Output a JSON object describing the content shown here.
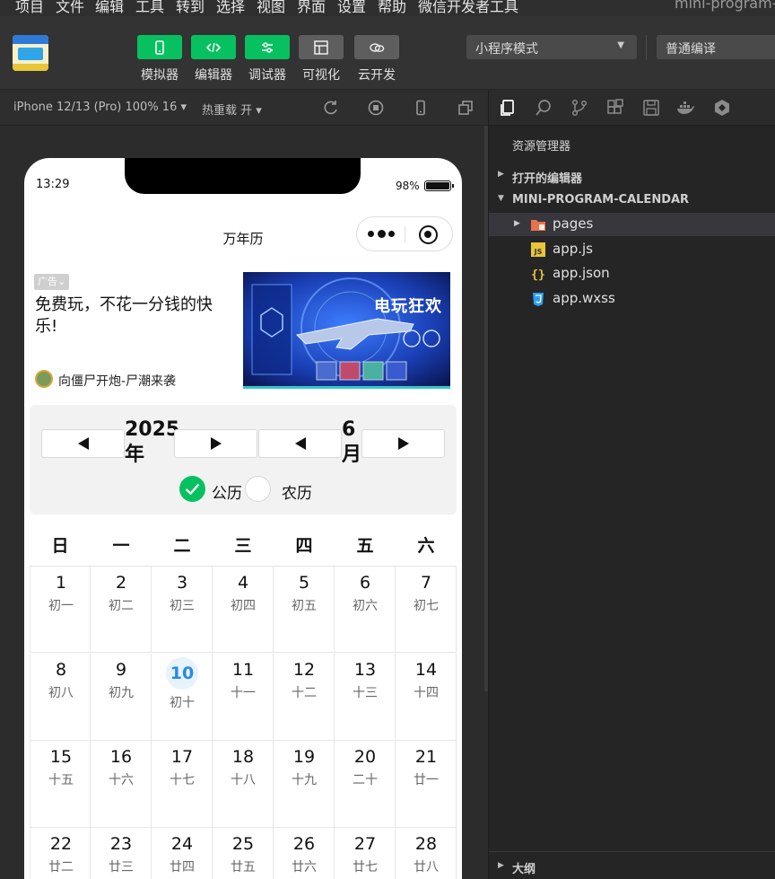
{
  "menubar": {
    "items": [
      "项目",
      "文件",
      "编辑",
      "工具",
      "转到",
      "选择",
      "视图",
      "界面",
      "设置",
      "帮助",
      "微信开发者工具"
    ],
    "window_title": "mini-program-c"
  },
  "toolbar": {
    "buttons": [
      {
        "label": "模拟器",
        "icon": "phone-icon",
        "active": true
      },
      {
        "label": "编辑器",
        "icon": "code-icon",
        "active": true
      },
      {
        "label": "调试器",
        "icon": "debug-icon",
        "active": true
      },
      {
        "label": "可视化",
        "icon": "layout-icon",
        "active": false
      },
      {
        "label": "云开发",
        "icon": "cloud-icon",
        "active": false
      }
    ],
    "mode_select": "小程序模式",
    "compile_select": "普通编译"
  },
  "simulator": {
    "device": "iPhone 12/13 (Pro) 100% 16 ▾",
    "hot_reload": "热重载 开 ▾"
  },
  "phone": {
    "status_time": "13:29",
    "battery": "98%",
    "nav_title": "万年历",
    "ad": {
      "badge": "广告⌄",
      "text": "免费玩，不花一分钱的快乐!",
      "source": "向僵尸开炮-尸潮来袭",
      "image_title": "电玩狂欢"
    },
    "selector": {
      "year": "2025",
      "year_unit": "年",
      "month": "6",
      "month_unit": "月",
      "calendar_types": [
        "公历",
        "农历"
      ],
      "selected_type": "公历"
    },
    "weekdays": [
      "日",
      "一",
      "二",
      "三",
      "四",
      "五",
      "六"
    ],
    "today": "10",
    "days": [
      {
        "num": "1",
        "lunar": "初一"
      },
      {
        "num": "2",
        "lunar": "初二"
      },
      {
        "num": "3",
        "lunar": "初三"
      },
      {
        "num": "4",
        "lunar": "初四"
      },
      {
        "num": "5",
        "lunar": "初五"
      },
      {
        "num": "6",
        "lunar": "初六"
      },
      {
        "num": "7",
        "lunar": "初七"
      },
      {
        "num": "8",
        "lunar": "初八"
      },
      {
        "num": "9",
        "lunar": "初九"
      },
      {
        "num": "10",
        "lunar": "初十"
      },
      {
        "num": "11",
        "lunar": "十一"
      },
      {
        "num": "12",
        "lunar": "十二"
      },
      {
        "num": "13",
        "lunar": "十三"
      },
      {
        "num": "14",
        "lunar": "十四"
      },
      {
        "num": "15",
        "lunar": "十五"
      },
      {
        "num": "16",
        "lunar": "十六"
      },
      {
        "num": "17",
        "lunar": "十七"
      },
      {
        "num": "18",
        "lunar": "十八"
      },
      {
        "num": "19",
        "lunar": "十九"
      },
      {
        "num": "20",
        "lunar": "二十"
      },
      {
        "num": "21",
        "lunar": "廿一"
      },
      {
        "num": "22",
        "lunar": "廿二"
      },
      {
        "num": "23",
        "lunar": "廿三"
      },
      {
        "num": "24",
        "lunar": "廿四"
      },
      {
        "num": "25",
        "lunar": "廿五"
      },
      {
        "num": "26",
        "lunar": "廿六"
      },
      {
        "num": "27",
        "lunar": "廿七"
      },
      {
        "num": "28",
        "lunar": "廿八"
      }
    ]
  },
  "explorer": {
    "title": "资源管理器",
    "open_editors": "打开的编辑器",
    "project": "MINI-PROGRAM-CALENDAR",
    "files": [
      {
        "name": "pages",
        "type": "folder"
      },
      {
        "name": "app.js",
        "type": "js"
      },
      {
        "name": "app.json",
        "type": "json"
      },
      {
        "name": "app.wxss",
        "type": "wxss"
      }
    ],
    "outline": "大纲"
  },
  "colors": {
    "accent_green": "#07c160",
    "today_blue": "#2b88e3",
    "folder_orange": "#e8734a",
    "js_yellow": "#e8c53a",
    "wxss_blue": "#2b9ff4"
  }
}
